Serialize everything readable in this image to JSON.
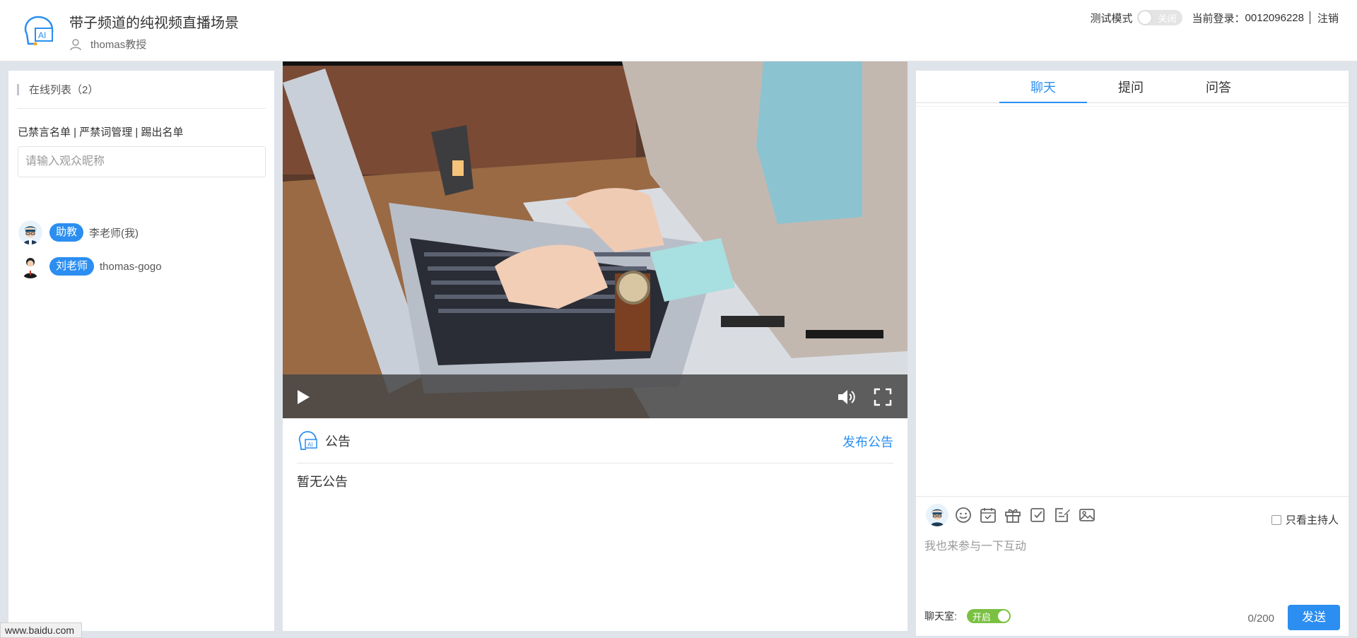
{
  "header": {
    "title": "带子频道的纯视频直播场景",
    "teacher": "thomas教授",
    "test_mode_label": "测试模式",
    "test_mode_toggle": "关闭",
    "login_label": "当前登录：",
    "login_id": "0012096228",
    "logout": "注销"
  },
  "left": {
    "online_title": "在线列表（2）",
    "links": [
      "已禁言名单",
      "严禁词管理",
      "踢出名单"
    ],
    "link_separator": " | ",
    "search_placeholder": "请输入观众昵称",
    "users": [
      {
        "role": "助教",
        "name": "李老师(我)"
      },
      {
        "role": "刘老师",
        "name": "thomas-gogo"
      }
    ]
  },
  "notice": {
    "title": "公告",
    "publish": "发布公告",
    "empty": "暂无公告"
  },
  "right": {
    "tabs": [
      "聊天",
      "提问",
      "问答"
    ],
    "active_tab": 0,
    "host_only": "只看主持人",
    "input_placeholder": "我也来参与一下互动",
    "chatroom_label": "聊天室:",
    "chatroom_toggle": "开启",
    "counter": "0/200",
    "send": "发送"
  },
  "tool_icons": [
    "emoji-icon",
    "calendar-icon",
    "gift-icon",
    "sign-in-icon",
    "note-icon",
    "image-icon"
  ],
  "colors": {
    "accent": "#2b8ef0",
    "toggle_on": "#7ac143"
  },
  "status_bar": "www.baidu.com"
}
